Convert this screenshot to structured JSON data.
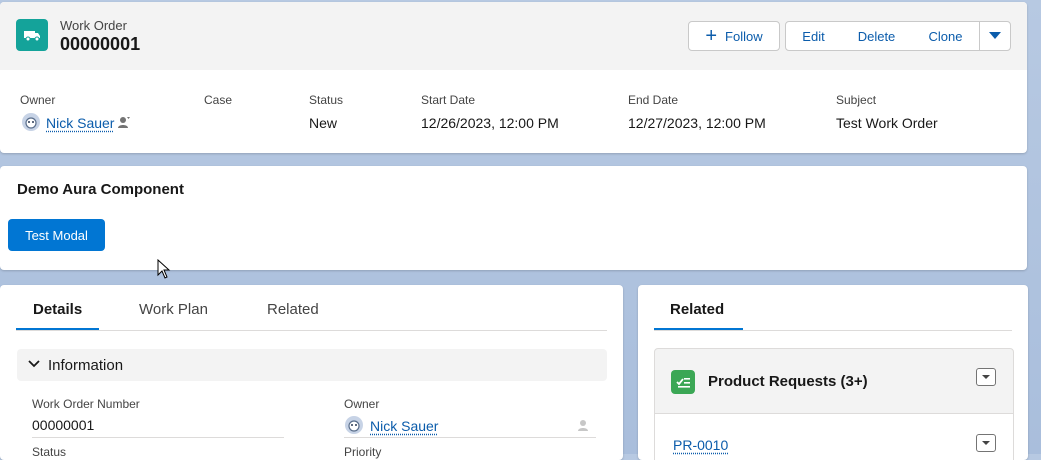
{
  "header": {
    "object_type": "Work Order",
    "record_name": "00000001",
    "icon": "truck-icon",
    "accent_color": "#14a39a",
    "buttons": {
      "follow": "Follow",
      "edit": "Edit",
      "delete": "Delete",
      "clone": "Clone"
    },
    "fields": [
      {
        "label": "Owner",
        "value": "Nick Sauer"
      },
      {
        "label": "Case",
        "value": ""
      },
      {
        "label": "Status",
        "value": "New"
      },
      {
        "label": "Start Date",
        "value": "12/26/2023, 12:00 PM"
      },
      {
        "label": "End Date",
        "value": "12/27/2023, 12:00 PM"
      },
      {
        "label": "Subject",
        "value": "Test Work Order"
      }
    ]
  },
  "aura": {
    "title": "Demo Aura Component",
    "button": "Test Modal",
    "button_color": "#0176d3"
  },
  "details": {
    "tabs": [
      "Details",
      "Work Plan",
      "Related"
    ],
    "section": "Information",
    "fields": [
      {
        "label": "Work Order Number",
        "value": "00000001"
      },
      {
        "label": "Owner",
        "value": "Nick Sauer"
      },
      {
        "label": "Status",
        "value": ""
      },
      {
        "label": "Priority",
        "value": ""
      }
    ]
  },
  "related": {
    "tab": "Related",
    "list_title": "Product Requests (3+)",
    "list_icon": "product-request-icon",
    "list_icon_color": "#3ba755",
    "items": [
      "PR-0010"
    ]
  }
}
